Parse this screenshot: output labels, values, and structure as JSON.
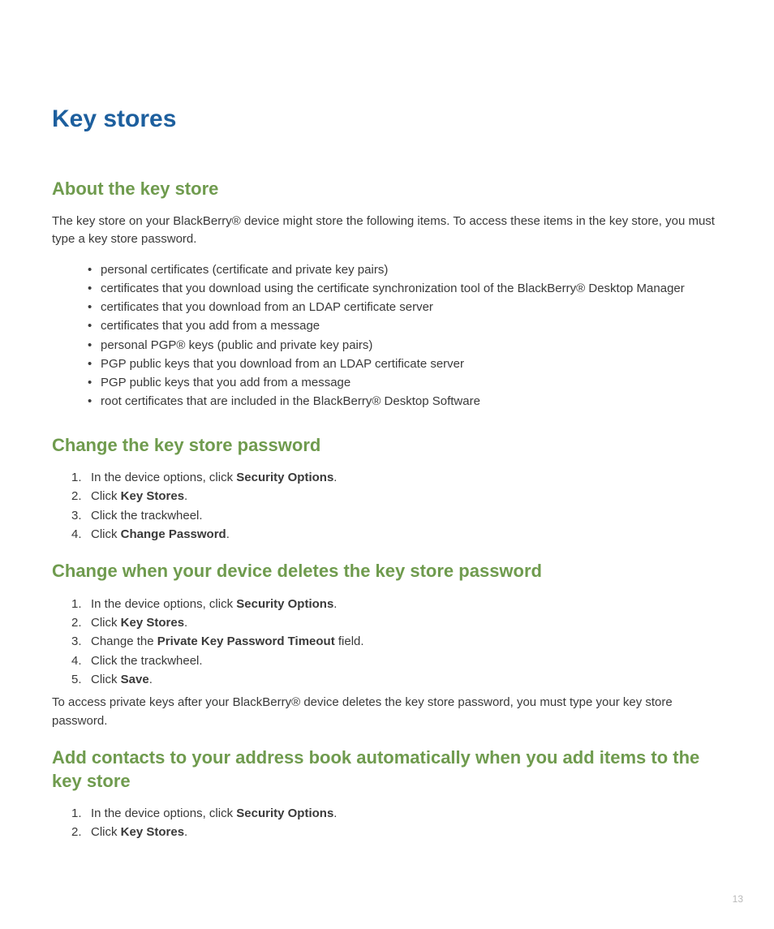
{
  "h1": "Key stores",
  "section1": {
    "heading": "About the key store",
    "intro": "The key store on your BlackBerry® device might store the following items. To access these items in the key store, you must type a key store password.",
    "bullets": [
      "personal certificates (certificate and private key pairs)",
      "certificates that you download using the certificate synchronization tool of the BlackBerry® Desktop Manager",
      "certificates that you download from an LDAP certificate server",
      "certificates that you add from a message",
      "personal PGP® keys (public and private key pairs)",
      "PGP public keys that you download from an LDAP certificate server",
      "PGP public keys that you add from a message",
      "root certificates that are included in the BlackBerry® Desktop Software"
    ]
  },
  "section2": {
    "heading": "Change the key store password",
    "steps": [
      {
        "pre": "In the device options, click ",
        "bold": "Security Options",
        "post": "."
      },
      {
        "pre": "Click ",
        "bold": "Key Stores",
        "post": "."
      },
      {
        "pre": "Click the trackwheel.",
        "bold": "",
        "post": ""
      },
      {
        "pre": "Click ",
        "bold": "Change Password",
        "post": "."
      }
    ]
  },
  "section3": {
    "heading": "Change when your device deletes the key store password",
    "steps": [
      {
        "pre": "In the device options, click ",
        "bold": "Security Options",
        "post": "."
      },
      {
        "pre": "Click ",
        "bold": "Key Stores",
        "post": "."
      },
      {
        "pre": "Change the ",
        "bold": "Private Key Password Timeout",
        "post": " field."
      },
      {
        "pre": "Click the trackwheel.",
        "bold": "",
        "post": ""
      },
      {
        "pre": "Click ",
        "bold": "Save",
        "post": "."
      }
    ],
    "note": "To access private keys after your BlackBerry® device deletes the key store password, you must type your key store password."
  },
  "section4": {
    "heading": "Add contacts to your address book automatically when you add items to the key store",
    "steps": [
      {
        "pre": "In the device options, click ",
        "bold": "Security Options",
        "post": "."
      },
      {
        "pre": "Click ",
        "bold": "Key Stores",
        "post": "."
      }
    ]
  },
  "page_number": "13"
}
